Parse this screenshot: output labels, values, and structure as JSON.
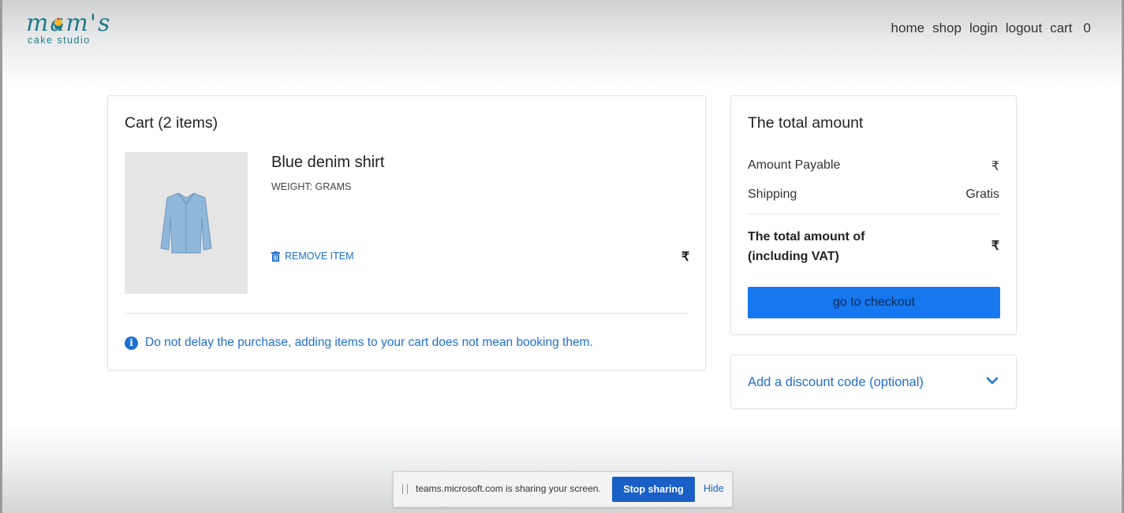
{
  "brand": {
    "name": "mam's",
    "tagline": "cake studio"
  },
  "nav": {
    "home": "home",
    "shop": "shop",
    "login": "login",
    "logout": "logout",
    "cart": "cart",
    "cart_count": "0"
  },
  "cart": {
    "title": "Cart (2 items)",
    "item": {
      "name": "Blue denim shirt",
      "weight": "WEIGHT: GRAMS",
      "remove_label": "REMOVE ITEM",
      "price": "₹",
      "image_icon": "shirt-image"
    },
    "notice": "Do not delay the purchase, adding items to your cart does not mean booking them."
  },
  "summary": {
    "title": "The total amount",
    "amount_payable_label": "Amount Payable",
    "amount_payable_value": "₹",
    "shipping_label": "Shipping",
    "shipping_value": "Gratis",
    "total_label": "The total amount of (including VAT)",
    "total_value": "₹",
    "checkout_label": "go to checkout"
  },
  "discount": {
    "label": "Add a discount code (optional)"
  },
  "screen_share": {
    "message": "teams.microsoft.com is sharing your screen.",
    "stop_label": "Stop sharing",
    "hide_label": "Hide"
  },
  "colors": {
    "accent": "#1677ef",
    "link": "#1f6fd0",
    "brand": "#1f7b88"
  }
}
